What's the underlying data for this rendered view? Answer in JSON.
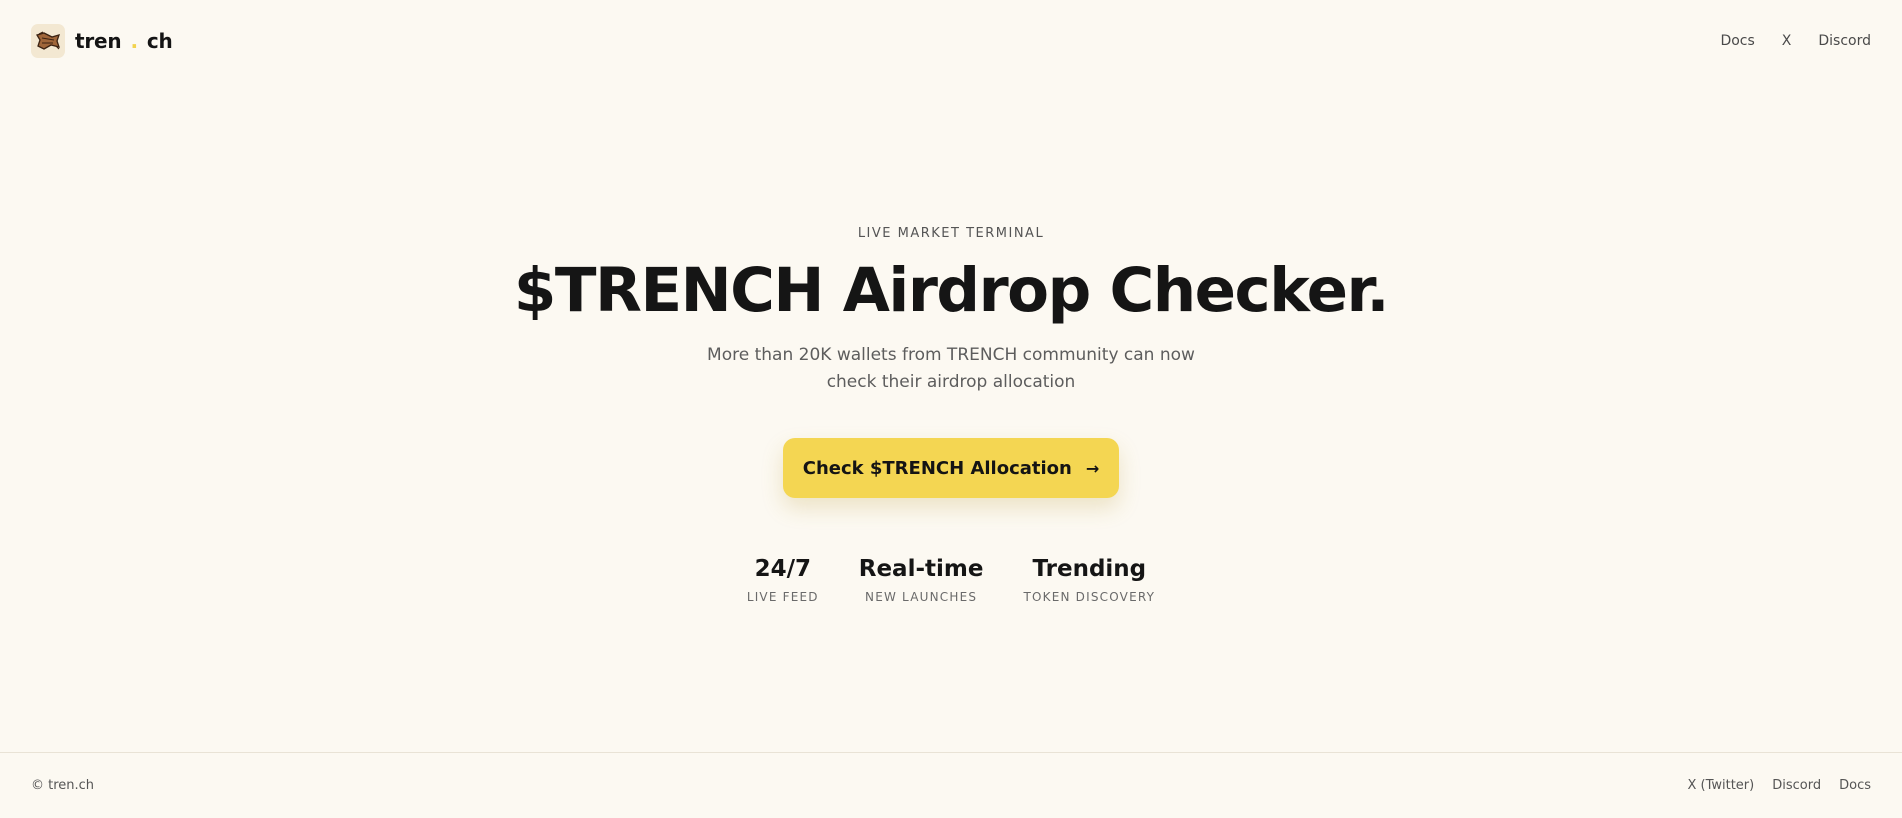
{
  "header": {
    "brand": {
      "part1": "tren",
      "dot": ".",
      "part2": "ch"
    },
    "nav": [
      "Docs",
      "X",
      "Discord"
    ]
  },
  "hero": {
    "eyebrow": "LIVE MARKET TERMINAL",
    "headline": "$TRENCH Airdrop Checker.",
    "subtext": "More than 20K wallets from TRENCH community can now check their airdrop allocation",
    "cta": {
      "label": "Check $TRENCH Allocation",
      "icon": "arrow-right-icon"
    }
  },
  "stats": [
    {
      "value": "24/7",
      "label": "LIVE FEED"
    },
    {
      "value": "Real-time",
      "label": "NEW LAUNCHES"
    },
    {
      "value": "Trending",
      "label": "TOKEN DISCOVERY"
    }
  ],
  "footer": {
    "copyright": "© tren.ch",
    "links": [
      "X (Twitter)",
      "Discord",
      "Docs"
    ]
  },
  "colors": {
    "background": "#fcf9f2",
    "accent": "#f4d652",
    "text": "#151515"
  }
}
